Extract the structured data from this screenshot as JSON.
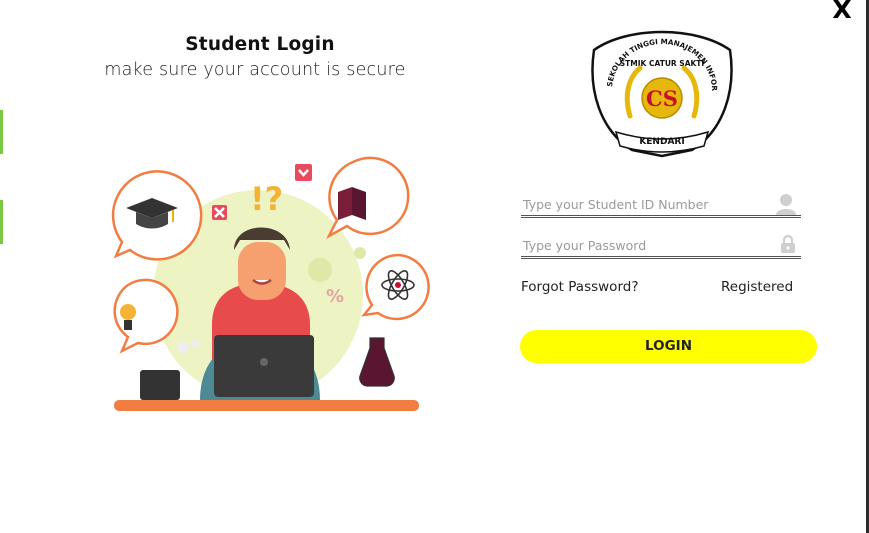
{
  "window": {
    "close_label": "X"
  },
  "header": {
    "title": "Student Login",
    "subtitle": "make sure your account is secure"
  },
  "logo": {
    "icon": "school-crest-icon",
    "ring_text": "SEKOLAH TINGGI MANAJEMEN INFORMATIKA KOMPUTER",
    "inner_text": "STMIK CATUR SAKTI",
    "monogram": "CS",
    "banner_text": "KENDARI"
  },
  "form": {
    "student_id": {
      "placeholder": "Type your Student ID Number",
      "value": "",
      "icon": "user-icon"
    },
    "password": {
      "placeholder": "Type your Password",
      "value": "",
      "icon": "lock-icon"
    },
    "forgot_label": "Forgot Password?",
    "register_label": "Registered",
    "login_label": "LOGIN"
  },
  "illustration": {
    "icon": "student-at-laptop-illustration",
    "marks": [
      "!?",
      "%"
    ]
  },
  "colors": {
    "accent": "#ffff00",
    "orange": "#f27d42",
    "tab_green": "#7ac943",
    "crest_red": "#c8102e",
    "crest_gold": "#e5b80b"
  }
}
